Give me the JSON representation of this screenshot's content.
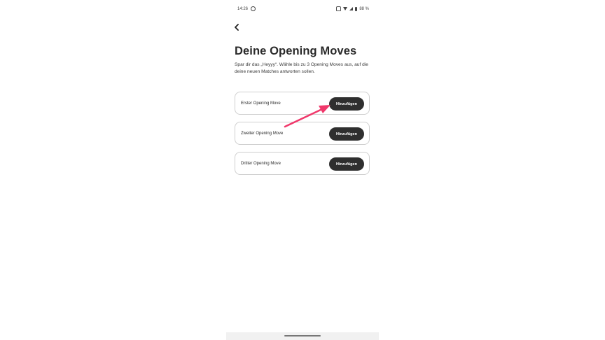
{
  "status_bar": {
    "time": "14:26",
    "battery": "88 %"
  },
  "header": {
    "title": "Deine Opening Moves",
    "subtitle": "Spar dir das „Heyyy“. Wähle bis zu 3 Opening Moves aus, auf die deine neuen Matches antworten sollen."
  },
  "moves": [
    {
      "label": "Erster Opening Move",
      "button": "Hinzufügen"
    },
    {
      "label": "Zweiter Opening Move",
      "button": "Hinzufügen"
    },
    {
      "label": "Dritter Opening Move",
      "button": "Hinzufügen"
    }
  ],
  "colors": {
    "button_bg": "#2f2f2f",
    "annotation_arrow": "#f0386b"
  },
  "icons": [
    "whatsapp-icon",
    "mute-icon",
    "wifi-icon",
    "signal-icon",
    "battery-icon",
    "back-arrow-icon"
  ]
}
